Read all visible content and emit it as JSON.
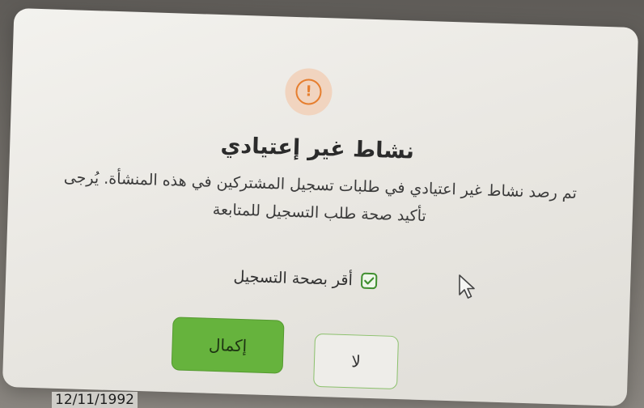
{
  "dialog": {
    "icon": "exclamation-circle-icon",
    "icon_glyph": "!",
    "title": "نشاط غير إعتيادي",
    "message_line1": "تم رصد نشاط غير اعتيادي في طلبات تسجيل المشتركين في هذه المنشأة. يُرجى",
    "message_line2": "تأكيد صحة طلب التسجيل للمتابعة",
    "checkbox_label": "أقر بصحة التسجيل",
    "checkbox_checked": true,
    "confirm_label": "إكمال",
    "cancel_label": "لا"
  },
  "footer": {
    "date": "12/11/1992"
  },
  "colors": {
    "accent": "#66b33d",
    "warning": "#e67e2e",
    "icon_bg": "#f1d4bf"
  }
}
